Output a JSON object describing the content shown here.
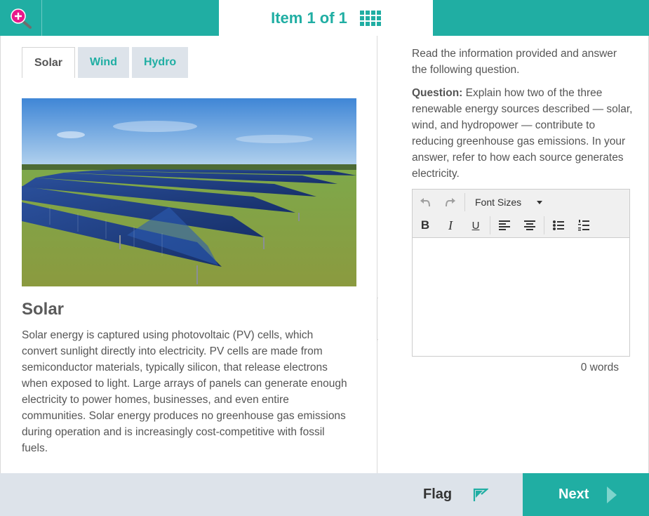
{
  "header": {
    "zoom_icon": "zoom-in-icon",
    "item_label": "Item 1 of 1",
    "grid_icon": "grid-icon"
  },
  "stimulus": {
    "tabs": [
      {
        "label": "Solar",
        "active": true
      },
      {
        "label": "Wind",
        "active": false
      },
      {
        "label": "Hydro",
        "active": false
      }
    ],
    "image_icon": "solar-farm-photo",
    "heading": "Solar",
    "body": "Solar energy is captured using photovoltaic (PV) cells, which convert sunlight directly into electricity. PV cells are made from semiconductor materials, typically silicon, that release electrons when exposed to light. Large arrays of panels can generate enough electricity to power homes, businesses, and even entire communities. Solar energy produces no greenhouse gas emissions during operation and is increasingly cost-competitive with fossil fuels."
  },
  "panel_toggle": {
    "icon": "chevron-right-icon"
  },
  "response": {
    "instructions": "Read the information provided and answer the following question.",
    "question_label": "Question:",
    "question_text": "Explain how two of the three renewable energy sources described — solar, wind, and hydropower — contribute to reducing greenhouse gas emissions. In your answer, refer to how each source generates electricity.",
    "editor": {
      "undo_icon": "undo-icon",
      "redo_icon": "redo-icon",
      "font_sizes_label": "Font Sizes",
      "bold_label": "B",
      "italic_label": "I",
      "underline_label": "U",
      "align_left_icon": "align-left-icon",
      "align_center_icon": "align-center-icon",
      "bullet_list_icon": "bullet-list-icon",
      "numbered_list_icon": "numbered-list-icon",
      "value": ""
    },
    "word_count": "0 words"
  },
  "footer": {
    "flag_label": "Flag",
    "flag_icon": "flag-icon",
    "next_label": "Next",
    "next_icon": "play-arrow-icon"
  },
  "colors": {
    "accent": "#20aea3",
    "footer_bg": "#dde3ea",
    "zoom_badge": "#e8198b"
  }
}
